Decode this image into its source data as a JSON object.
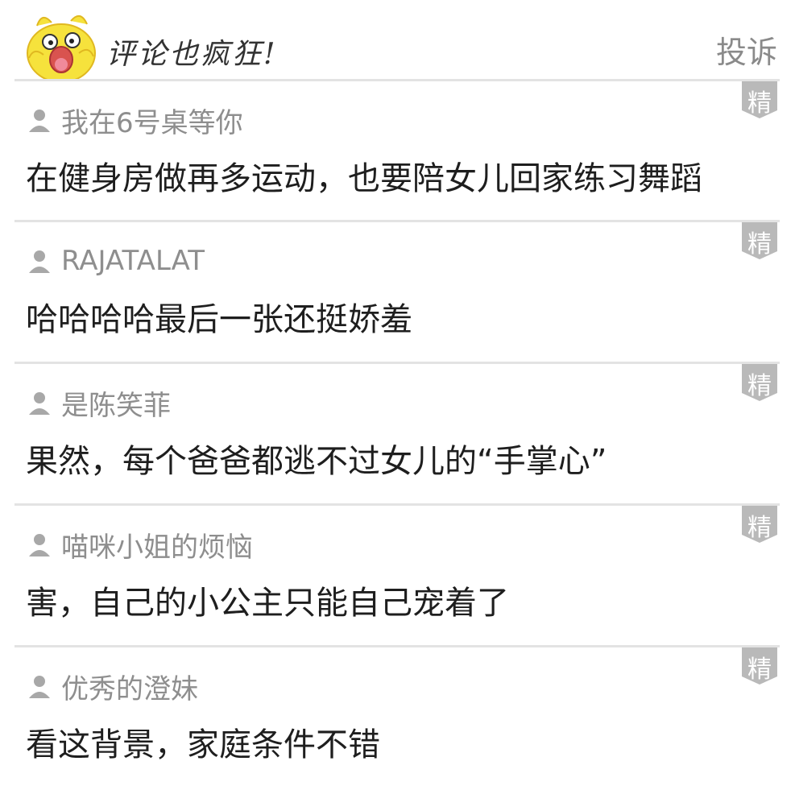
{
  "header": {
    "title": "评论也疯狂!",
    "report_label": "投诉",
    "mascot_icon": "yellow-chick-mascot-icon"
  },
  "badge_label": "精",
  "comments": [
    {
      "username": "我在6号桌等你",
      "text": "在健身房做再多运动，也要陪女儿回家练习舞蹈"
    },
    {
      "username": "RAJATALAT",
      "text": "哈哈哈哈最后一张还挺娇羞"
    },
    {
      "username": "是陈笑菲",
      "text": "果然，每个爸爸都逃不过女儿的“手掌心”"
    },
    {
      "username": "喵咪小姐的烦恼",
      "text": "害，自己的小公主只能自己宠着了"
    },
    {
      "username": "优秀的澄妹",
      "text": "看这背景，家庭条件不错"
    }
  ],
  "colors": {
    "badge": "#b9b9b9",
    "username": "#8e8e8e",
    "divider": "#e3e3e3",
    "mascot": "#f6e23c"
  }
}
